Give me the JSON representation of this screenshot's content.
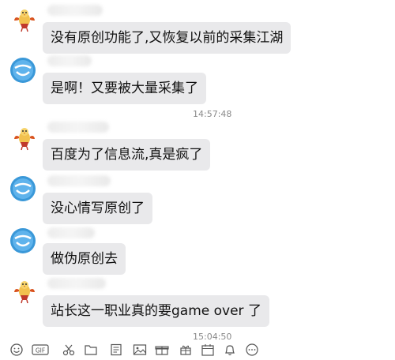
{
  "messages": [
    {
      "id": "m1",
      "sender": "bird",
      "text": "没有原创功能了,又恢复以前的采集江湖"
    },
    {
      "id": "m2",
      "sender": "face",
      "text": "是啊！又要被大量采集了"
    },
    {
      "id": "m3",
      "sender": "bird",
      "text": "百度为了信息流,真是疯了"
    },
    {
      "id": "m4",
      "sender": "face",
      "text": "没心情写原创了"
    },
    {
      "id": "m5",
      "sender": "face",
      "text": "做伪原创去"
    },
    {
      "id": "m6",
      "sender": "bird",
      "text": "站长这一职业真的要game over 了"
    }
  ],
  "timestamps": {
    "t1": "14:57:48",
    "t2": "15:04:50"
  },
  "toolbar": {
    "gif_label": "GIF",
    "icons": [
      "emoji-icon",
      "gif-icon",
      "scissors-icon",
      "folder-icon",
      "doc-icon",
      "image-icon",
      "gift-box-icon",
      "present-icon",
      "calendar-icon",
      "bell-icon",
      "more-icon"
    ]
  },
  "colors": {
    "bubble": "#e9e9eb",
    "timestamp": "#8a8a8a",
    "avatar_face": "#3a98d8",
    "avatar_bird": "#e8a23c"
  }
}
